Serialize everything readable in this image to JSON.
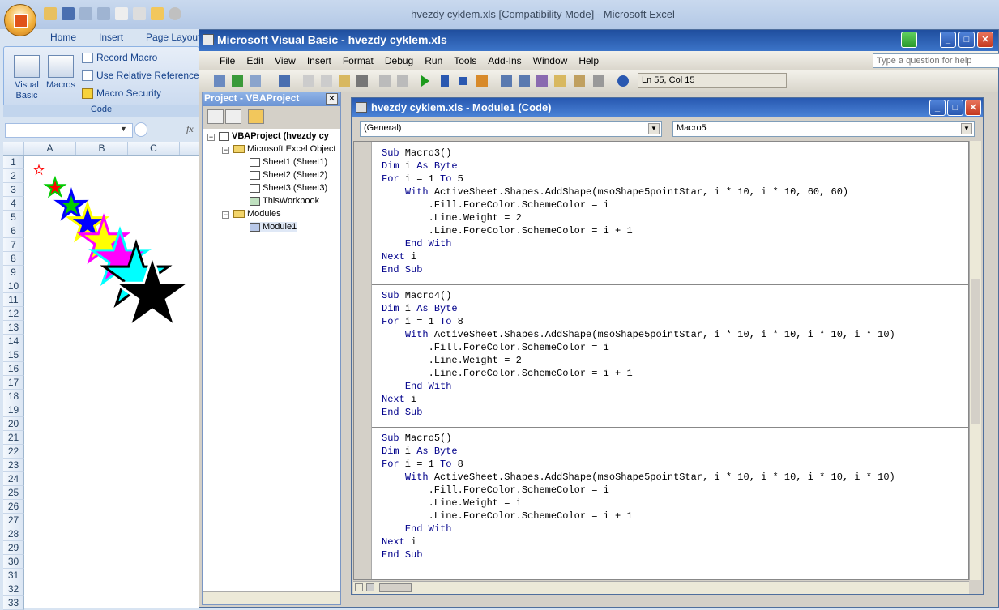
{
  "excel": {
    "title": "hvezdy cyklem.xls  [Compatibility Mode] - Microsoft Excel",
    "ribbon_tabs": [
      "Home",
      "Insert",
      "Page Layout"
    ],
    "ribbon": {
      "visual_basic": "Visual Basic",
      "macros": "Macros",
      "record_macro": "Record Macro",
      "relative_refs": "Use Relative References",
      "macro_security": "Macro Security",
      "group_label": "Code"
    },
    "fx": "fx",
    "columns": [
      "A",
      "B",
      "C"
    ],
    "rows": [
      "1",
      "2",
      "3",
      "4",
      "5",
      "6",
      "7",
      "8",
      "9",
      "10",
      "11",
      "12",
      "13",
      "14",
      "15",
      "16",
      "17",
      "18",
      "19",
      "20",
      "21",
      "22",
      "23",
      "24",
      "25",
      "26",
      "27",
      "28",
      "29",
      "30",
      "31",
      "32",
      "33"
    ]
  },
  "vbe": {
    "title": "Microsoft Visual Basic - hvezdy cyklem.xls",
    "menu": [
      "File",
      "Edit",
      "View",
      "Insert",
      "Format",
      "Debug",
      "Run",
      "Tools",
      "Add-Ins",
      "Window",
      "Help"
    ],
    "help_placeholder": "Type a question for help",
    "cursor_pos": "Ln 55, Col 15"
  },
  "project": {
    "title": "Project - VBAProject",
    "root": "VBAProject (hvezdy cy",
    "excel_objects": "Microsoft Excel Object",
    "sheet1": "Sheet1 (Sheet1)",
    "sheet2": "Sheet2 (Sheet2)",
    "sheet3": "Sheet3 (Sheet3)",
    "workbook": "ThisWorkbook",
    "modules": "Modules",
    "module1": "Module1"
  },
  "code_window": {
    "title": "hvezdy cyklem.xls - Module1 (Code)",
    "object_dropdown": "(General)",
    "proc_dropdown": "Macro5",
    "macro3": [
      "Sub Macro3()",
      "Dim i As Byte",
      "For i = 1 To 5",
      "    With ActiveSheet.Shapes.AddShape(msoShape5pointStar, i * 10, i * 10, 60, 60)",
      "        .Fill.ForeColor.SchemeColor = i",
      "        .Line.Weight = 2",
      "        .Line.ForeColor.SchemeColor = i + 1",
      "    End With",
      "Next i",
      "End Sub"
    ],
    "macro4": [
      "Sub Macro4()",
      "Dim i As Byte",
      "For i = 1 To 8",
      "    With ActiveSheet.Shapes.AddShape(msoShape5pointStar, i * 10, i * 10, i * 10, i * 10)",
      "        .Fill.ForeColor.SchemeColor = i",
      "        .Line.Weight = 2",
      "        .Line.ForeColor.SchemeColor = i + 1",
      "    End With",
      "Next i",
      "End Sub"
    ],
    "macro5": [
      "Sub Macro5()",
      "Dim i As Byte",
      "For i = 1 To 8",
      "    With ActiveSheet.Shapes.AddShape(msoShape5pointStar, i * 10, i * 10, i * 10, i * 10)",
      "        .Fill.ForeColor.SchemeColor = i",
      "        .Line.Weight = i",
      "        .Line.ForeColor.SchemeColor = i + 1",
      "    End With",
      "Next i",
      "End Sub"
    ]
  },
  "colors": {
    "keyword": "#00008b",
    "star_colors": [
      "#ffffff",
      "#ff0000",
      "#00cc00",
      "#0000ff",
      "#ffff00",
      "#ff00ff",
      "#00ffff",
      "#000000"
    ]
  }
}
